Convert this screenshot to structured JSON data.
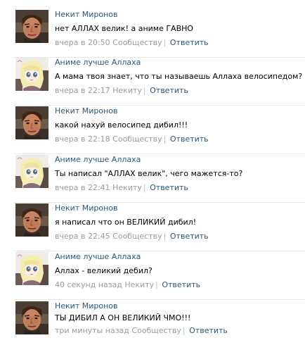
{
  "comments": [
    {
      "avatar": "man-avatar",
      "author": "Некит Миронов",
      "text": "нет АЛЛАХ велик! а аниме ГАВНО",
      "time": "вчера в 20:50",
      "target": "Сообществу",
      "reply_label": "Ответить"
    },
    {
      "avatar": "anime-girl-avatar",
      "author": "Аниме лучше Аллаха",
      "text": "А мама твоя знает, что ты называешь Аллаха велосипедом?",
      "time": "вчера в 22:17",
      "target": "Некиту",
      "reply_label": "Ответить"
    },
    {
      "avatar": "man-avatar",
      "author": "Некит Миронов",
      "text": "какой нахуй велосипед дибил!!!",
      "time": "вчера в 22:18",
      "target": "Сообществу",
      "reply_label": "Ответить"
    },
    {
      "avatar": "anime-girl-avatar",
      "author": "Аниме лучше Аллаха",
      "text": "Ты написал \"АЛЛАХ велик\", чего мажется-то?",
      "time": "вчера в 22:41",
      "target": "Некиту",
      "reply_label": "Ответить"
    },
    {
      "avatar": "man-avatar",
      "author": "Некит Миронов",
      "text": "я написал что он ВЕЛИКИЙ дибил!",
      "time": "вчера в 22:45",
      "target": "Сообществу",
      "reply_label": "Ответить"
    },
    {
      "avatar": "anime-girl-avatar",
      "author": "Аниме лучше Аллаха",
      "text": "Аллах - великий дебил?",
      "time": "40 секунд назад",
      "target": "Некиту",
      "reply_label": "Ответить"
    },
    {
      "avatar": "man-avatar",
      "author": "Некит Миронов",
      "text": "ТЫ ДИБИЛ А ОН ВЕЛИКИЙ ЧМО!!!",
      "time": "три минуты назад",
      "target": "Сообществу",
      "reply_label": "Ответить"
    }
  ]
}
